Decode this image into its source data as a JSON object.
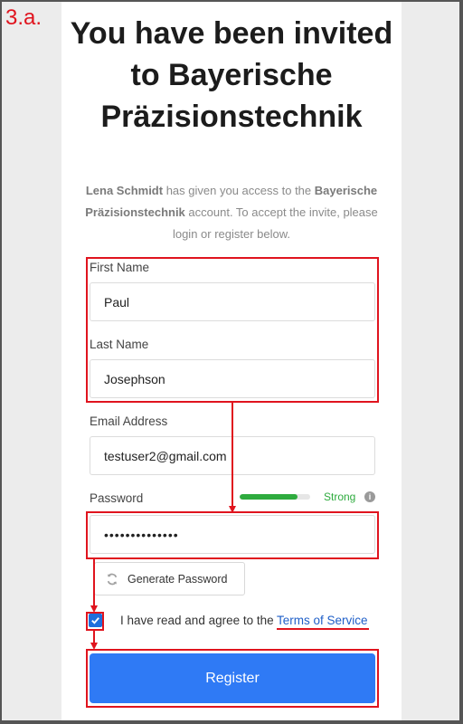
{
  "step_label": "3.a.",
  "title": "You have been invited to Bayerische Präzisionstechnik",
  "subtitle": {
    "inviter": "Lena Schmidt",
    "text1": " has given you access to the ",
    "company": "Bayerische Präzisionstechnik",
    "text2": " account. To accept the invite, please login or register below."
  },
  "form": {
    "first_name_label": "First Name",
    "first_name_value": "Paul",
    "last_name_label": "Last Name",
    "last_name_value": "Josephson",
    "email_label": "Email Address",
    "email_value": "testuser2@gmail.com",
    "password_label": "Password",
    "password_value": "••••••••••••••",
    "password_strength": "Strong",
    "password_strength_level": 0.82,
    "generate_password_label": "Generate Password",
    "agree_text": "I have read and agree to the",
    "terms_link": "Terms of Service",
    "terms_checked": true,
    "register_label": "Register"
  },
  "colors": {
    "primary": "#2f7af5",
    "strength": "#2eab3e",
    "annotation": "#e0141e",
    "link": "#1f5fc8"
  },
  "icons": {
    "generate": "refresh-icon",
    "info": "info-icon",
    "check": "checkmark-icon"
  }
}
